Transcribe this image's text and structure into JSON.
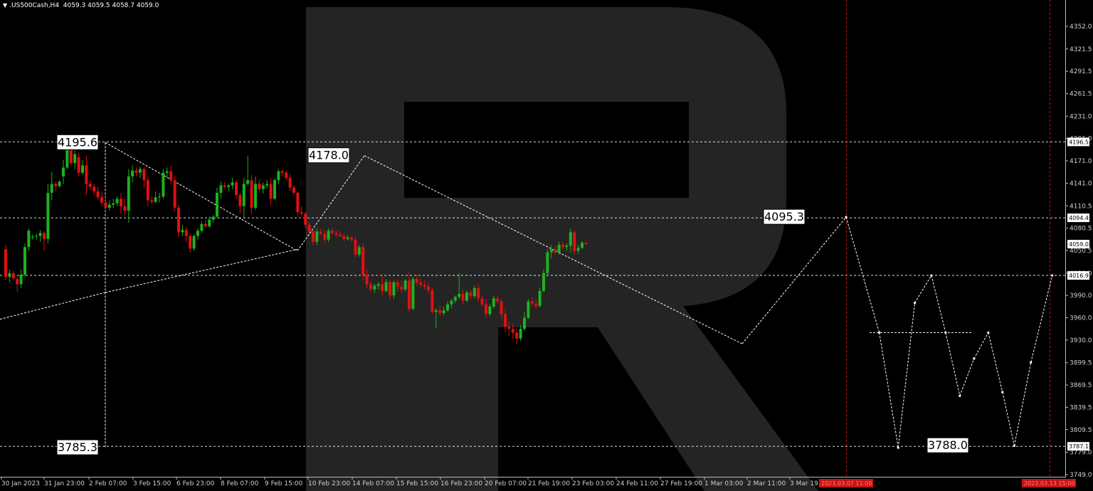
{
  "header": {
    "symbol": ".US500Cash,H4",
    "ohlc": "4059.3 4059.5 4058.7 4059.0"
  },
  "colors": {
    "background": "#000000",
    "bull": "#1db21d",
    "bear": "#e01010",
    "grid": "#ffffff",
    "vline": "#c81414",
    "watermark": "#2a2a2a"
  },
  "chart_data": {
    "type": "candlestick",
    "ylim": [
      3749.0,
      4372.0
    ],
    "y_ticks": [
      4352.0,
      4321.5,
      4291.5,
      4261.5,
      4231.0,
      4201.0,
      4171.0,
      4141.0,
      4110.5,
      4080.5,
      4050.5,
      4020.0,
      3990.0,
      3960.0,
      3930.0,
      3899.5,
      3869.5,
      3839.5,
      3809.5,
      3779.0,
      3749.0
    ],
    "x_labels": [
      "30 Jan 2023",
      "31 Jan 23:00",
      "2 Feb 07:00",
      "3 Feb 15:00",
      "6 Feb 23:00",
      "8 Feb 07:00",
      "9 Feb 15:00",
      "10 Feb 23:00",
      "14 Feb 07:00",
      "15 Feb 15:00",
      "16 Feb 23:00",
      "20 Feb 07:00",
      "21 Feb 19:00",
      "23 Feb 03:00",
      "24 Feb 11:00",
      "27 Feb 19:00",
      "1 Mar 03:00",
      "2 Mar 11:00",
      "3 Mar 19:00"
    ],
    "time_markers": [
      "2023.03.07 11:00",
      "2023.03.13 15:00"
    ],
    "price_tags": [
      {
        "value": 4196.5,
        "label": "4196.5",
        "color": "#ffffff"
      },
      {
        "value": 4094.4,
        "label": "4094.4",
        "color": "#ffffff"
      },
      {
        "value": 4059.0,
        "label": "4059.0",
        "color": "#ffffff"
      },
      {
        "value": 4016.9,
        "label": "4016.9",
        "color": "#ffffff"
      },
      {
        "value": 3787.1,
        "label": "3787.1",
        "color": "#ffffff"
      }
    ],
    "horizontal_levels": [
      4196.5,
      4094.4,
      4016.9,
      3787.1
    ],
    "annotations": [
      {
        "label": "4195.6",
        "value": 4195.6
      },
      {
        "label": "4178.0",
        "value": 4178.0
      },
      {
        "label": "4095.3",
        "value": 4095.3
      },
      {
        "label": "3785.3",
        "value": 3785.3
      },
      {
        "label": "3788.0",
        "value": 3788.0
      }
    ],
    "candles": [
      {
        "o": 4052,
        "h": 4058,
        "l": 4010,
        "c": 4015
      },
      {
        "o": 4015,
        "h": 4025,
        "l": 4008,
        "c": 4020
      },
      {
        "o": 4020,
        "h": 4023,
        "l": 4010,
        "c": 4013
      },
      {
        "o": 4012,
        "h": 4018,
        "l": 3995,
        "c": 4005
      },
      {
        "o": 4005,
        "h": 4025,
        "l": 4000,
        "c": 4018
      },
      {
        "o": 4018,
        "h": 4060,
        "l": 4015,
        "c": 4055
      },
      {
        "o": 4055,
        "h": 4080,
        "l": 4050,
        "c": 4077
      },
      {
        "o": 4068,
        "h": 4072,
        "l": 4065,
        "c": 4069
      },
      {
        "o": 4069,
        "h": 4073,
        "l": 4065,
        "c": 4070
      },
      {
        "o": 4070,
        "h": 4078,
        "l": 4062,
        "c": 4074
      },
      {
        "o": 4074,
        "h": 4076,
        "l": 4050,
        "c": 4066
      },
      {
        "o": 4066,
        "h": 4140,
        "l": 4060,
        "c": 4128
      },
      {
        "o": 4128,
        "h": 4156,
        "l": 4118,
        "c": 4140
      },
      {
        "o": 4140,
        "h": 4143,
        "l": 4130,
        "c": 4137
      },
      {
        "o": 4137,
        "h": 4145,
        "l": 4135,
        "c": 4143
      },
      {
        "o": 4150,
        "h": 4172,
        "l": 4140,
        "c": 4162
      },
      {
        "o": 4162,
        "h": 4193,
        "l": 4160,
        "c": 4188
      },
      {
        "o": 4188,
        "h": 4195,
        "l": 4165,
        "c": 4168
      },
      {
        "o": 4168,
        "h": 4185,
        "l": 4160,
        "c": 4180
      },
      {
        "o": 4176,
        "h": 4182,
        "l": 4150,
        "c": 4155
      },
      {
        "o": 4155,
        "h": 4172,
        "l": 4152,
        "c": 4165
      },
      {
        "o": 4165,
        "h": 4178,
        "l": 4125,
        "c": 4140
      },
      {
        "o": 4140,
        "h": 4145,
        "l": 4132,
        "c": 4136
      },
      {
        "o": 4136,
        "h": 4140,
        "l": 4125,
        "c": 4130
      },
      {
        "o": 4130,
        "h": 4136,
        "l": 4118,
        "c": 4122
      },
      {
        "o": 4122,
        "h": 4130,
        "l": 4110,
        "c": 4115
      },
      {
        "o": 4115,
        "h": 4125,
        "l": 4103,
        "c": 4108
      },
      {
        "o": 4108,
        "h": 4118,
        "l": 4104,
        "c": 4112
      },
      {
        "o": 4112,
        "h": 4120,
        "l": 4108,
        "c": 4114
      },
      {
        "o": 4114,
        "h": 4123,
        "l": 4110,
        "c": 4120
      },
      {
        "o": 4120,
        "h": 4128,
        "l": 4100,
        "c": 4110
      },
      {
        "o": 4110,
        "h": 4120,
        "l": 4098,
        "c": 4104
      },
      {
        "o": 4104,
        "h": 4160,
        "l": 4088,
        "c": 4150
      },
      {
        "o": 4150,
        "h": 4165,
        "l": 4142,
        "c": 4158
      },
      {
        "o": 4158,
        "h": 4162,
        "l": 4150,
        "c": 4155
      },
      {
        "o": 4155,
        "h": 4163,
        "l": 4148,
        "c": 4160
      },
      {
        "o": 4160,
        "h": 4162,
        "l": 4135,
        "c": 4145
      },
      {
        "o": 4145,
        "h": 4150,
        "l": 4110,
        "c": 4118
      },
      {
        "o": 4118,
        "h": 4124,
        "l": 4113,
        "c": 4116
      },
      {
        "o": 4116,
        "h": 4130,
        "l": 4114,
        "c": 4122
      },
      {
        "o": 4122,
        "h": 4128,
        "l": 4115,
        "c": 4123
      },
      {
        "o": 4123,
        "h": 4160,
        "l": 4120,
        "c": 4155
      },
      {
        "o": 4155,
        "h": 4162,
        "l": 4148,
        "c": 4157
      },
      {
        "o": 4157,
        "h": 4165,
        "l": 4140,
        "c": 4145
      },
      {
        "o": 4145,
        "h": 4150,
        "l": 4103,
        "c": 4108
      },
      {
        "o": 4108,
        "h": 4112,
        "l": 4068,
        "c": 4075
      },
      {
        "o": 4075,
        "h": 4085,
        "l": 4070,
        "c": 4078
      },
      {
        "o": 4078,
        "h": 4082,
        "l": 4062,
        "c": 4070
      },
      {
        "o": 4070,
        "h": 4073,
        "l": 4048,
        "c": 4053
      },
      {
        "o": 4053,
        "h": 4072,
        "l": 4050,
        "c": 4070
      },
      {
        "o": 4070,
        "h": 4080,
        "l": 4065,
        "c": 4077
      },
      {
        "o": 4077,
        "h": 4090,
        "l": 4074,
        "c": 4086
      },
      {
        "o": 4086,
        "h": 4092,
        "l": 4080,
        "c": 4083
      },
      {
        "o": 4083,
        "h": 4096,
        "l": 4081,
        "c": 4092
      },
      {
        "o": 4092,
        "h": 4098,
        "l": 4088,
        "c": 4096
      },
      {
        "o": 4096,
        "h": 4135,
        "l": 4094,
        "c": 4128
      },
      {
        "o": 4128,
        "h": 4143,
        "l": 4120,
        "c": 4138
      },
      {
        "o": 4138,
        "h": 4142,
        "l": 4133,
        "c": 4136
      },
      {
        "o": 4136,
        "h": 4140,
        "l": 4130,
        "c": 4138
      },
      {
        "o": 4138,
        "h": 4148,
        "l": 4133,
        "c": 4142
      },
      {
        "o": 4142,
        "h": 4145,
        "l": 4120,
        "c": 4125
      },
      {
        "o": 4125,
        "h": 4128,
        "l": 4100,
        "c": 4110
      },
      {
        "o": 4110,
        "h": 4148,
        "l": 4095,
        "c": 4140
      },
      {
        "o": 4140,
        "h": 4178,
        "l": 4138,
        "c": 4145
      },
      {
        "o": 4145,
        "h": 4152,
        "l": 4100,
        "c": 4108
      },
      {
        "o": 4108,
        "h": 4150,
        "l": 4105,
        "c": 4140
      },
      {
        "o": 4140,
        "h": 4145,
        "l": 4128,
        "c": 4133
      },
      {
        "o": 4133,
        "h": 4142,
        "l": 4127,
        "c": 4138
      },
      {
        "o": 4138,
        "h": 4145,
        "l": 4134,
        "c": 4140
      },
      {
        "o": 4140,
        "h": 4148,
        "l": 4112,
        "c": 4120
      },
      {
        "o": 4120,
        "h": 4148,
        "l": 4118,
        "c": 4145
      },
      {
        "o": 4145,
        "h": 4160,
        "l": 4140,
        "c": 4157
      },
      {
        "o": 4157,
        "h": 4160,
        "l": 4150,
        "c": 4155
      },
      {
        "o": 4155,
        "h": 4158,
        "l": 4145,
        "c": 4148
      },
      {
        "o": 4148,
        "h": 4153,
        "l": 4130,
        "c": 4135
      },
      {
        "o": 4135,
        "h": 4138,
        "l": 4125,
        "c": 4128
      },
      {
        "o": 4128,
        "h": 4130,
        "l": 4095,
        "c": 4102
      },
      {
        "o": 4102,
        "h": 4110,
        "l": 4095,
        "c": 4100
      },
      {
        "o": 4100,
        "h": 4103,
        "l": 4080,
        "c": 4085
      },
      {
        "o": 4085,
        "h": 4088,
        "l": 4070,
        "c": 4076
      },
      {
        "o": 4076,
        "h": 4080,
        "l": 4058,
        "c": 4062
      },
      {
        "o": 4062,
        "h": 4080,
        "l": 4058,
        "c": 4076
      },
      {
        "o": 4076,
        "h": 4080,
        "l": 4070,
        "c": 4073
      },
      {
        "o": 4073,
        "h": 4078,
        "l": 4060,
        "c": 4065
      },
      {
        "o": 4065,
        "h": 4080,
        "l": 4062,
        "c": 4077
      },
      {
        "o": 4077,
        "h": 4080,
        "l": 4072,
        "c": 4074
      },
      {
        "o": 4074,
        "h": 4078,
        "l": 4069,
        "c": 4072
      },
      {
        "o": 4072,
        "h": 4076,
        "l": 4068,
        "c": 4070
      },
      {
        "o": 4070,
        "h": 4073,
        "l": 4063,
        "c": 4066
      },
      {
        "o": 4066,
        "h": 4071,
        "l": 4064,
        "c": 4068
      },
      {
        "o": 4068,
        "h": 4070,
        "l": 4062,
        "c": 4065
      },
      {
        "o": 4065,
        "h": 4068,
        "l": 4040,
        "c": 4045
      },
      {
        "o": 4045,
        "h": 4058,
        "l": 4042,
        "c": 4055
      },
      {
        "o": 4055,
        "h": 4060,
        "l": 4010,
        "c": 4018
      },
      {
        "o": 4018,
        "h": 4025,
        "l": 4000,
        "c": 4005
      },
      {
        "o": 4005,
        "h": 4010,
        "l": 3995,
        "c": 3998
      },
      {
        "o": 3998,
        "h": 4006,
        "l": 3993,
        "c": 4003
      },
      {
        "o": 4003,
        "h": 4008,
        "l": 3998,
        "c": 4005
      },
      {
        "o": 4005,
        "h": 4018,
        "l": 3990,
        "c": 3996
      },
      {
        "o": 3996,
        "h": 4012,
        "l": 3994,
        "c": 4008
      },
      {
        "o": 4008,
        "h": 4012,
        "l": 3985,
        "c": 3990
      },
      {
        "o": 3990,
        "h": 4010,
        "l": 3985,
        "c": 4008
      },
      {
        "o": 4008,
        "h": 4012,
        "l": 3995,
        "c": 4002
      },
      {
        "o": 4002,
        "h": 4010,
        "l": 3994,
        "c": 3998
      },
      {
        "o": 3998,
        "h": 4012,
        "l": 3995,
        "c": 4010
      },
      {
        "o": 4010,
        "h": 4022,
        "l": 3968,
        "c": 3972
      },
      {
        "o": 3972,
        "h": 4015,
        "l": 3970,
        "c": 4012
      },
      {
        "o": 4012,
        "h": 4018,
        "l": 4003,
        "c": 4007
      },
      {
        "o": 4007,
        "h": 4013,
        "l": 4000,
        "c": 4004
      },
      {
        "o": 4004,
        "h": 4010,
        "l": 3998,
        "c": 4002
      },
      {
        "o": 4002,
        "h": 4006,
        "l": 3992,
        "c": 3997
      },
      {
        "o": 3997,
        "h": 4000,
        "l": 3965,
        "c": 3968
      },
      {
        "o": 3968,
        "h": 3973,
        "l": 3946,
        "c": 3970
      },
      {
        "o": 3970,
        "h": 3976,
        "l": 3962,
        "c": 3966
      },
      {
        "o": 3966,
        "h": 3975,
        "l": 3963,
        "c": 3970
      },
      {
        "o": 3970,
        "h": 3982,
        "l": 3968,
        "c": 3978
      },
      {
        "o": 3978,
        "h": 3985,
        "l": 3973,
        "c": 3983
      },
      {
        "o": 3983,
        "h": 3990,
        "l": 3980,
        "c": 3988
      },
      {
        "o": 3988,
        "h": 4020,
        "l": 3985,
        "c": 3992
      },
      {
        "o": 3992,
        "h": 3998,
        "l": 3978,
        "c": 3983
      },
      {
        "o": 3983,
        "h": 3997,
        "l": 3981,
        "c": 3994
      },
      {
        "o": 3994,
        "h": 3998,
        "l": 3985,
        "c": 3989
      },
      {
        "o": 3989,
        "h": 4003,
        "l": 3986,
        "c": 4000
      },
      {
        "o": 4000,
        "h": 4005,
        "l": 3982,
        "c": 3986
      },
      {
        "o": 3986,
        "h": 3990,
        "l": 3975,
        "c": 3978
      },
      {
        "o": 3978,
        "h": 3985,
        "l": 3960,
        "c": 3965
      },
      {
        "o": 3965,
        "h": 3978,
        "l": 3962,
        "c": 3975
      },
      {
        "o": 3975,
        "h": 3990,
        "l": 3972,
        "c": 3986
      },
      {
        "o": 3986,
        "h": 3990,
        "l": 3978,
        "c": 3982
      },
      {
        "o": 3982,
        "h": 3986,
        "l": 3958,
        "c": 3965
      },
      {
        "o": 3965,
        "h": 3972,
        "l": 3940,
        "c": 3948
      },
      {
        "o": 3948,
        "h": 3955,
        "l": 3935,
        "c": 3945
      },
      {
        "o": 3945,
        "h": 3952,
        "l": 3932,
        "c": 3940
      },
      {
        "o": 3940,
        "h": 3945,
        "l": 3925,
        "c": 3932
      },
      {
        "o": 3932,
        "h": 3950,
        "l": 3929,
        "c": 3945
      },
      {
        "o": 3945,
        "h": 3968,
        "l": 3942,
        "c": 3960
      },
      {
        "o": 3960,
        "h": 3985,
        "l": 3958,
        "c": 3982
      },
      {
        "o": 3982,
        "h": 3988,
        "l": 3975,
        "c": 3979
      },
      {
        "o": 3979,
        "h": 3985,
        "l": 3972,
        "c": 3976
      },
      {
        "o": 3976,
        "h": 4000,
        "l": 3974,
        "c": 3996
      },
      {
        "o": 3996,
        "h": 4025,
        "l": 3994,
        "c": 4020
      },
      {
        "o": 4020,
        "h": 4052,
        "l": 4018,
        "c": 4048
      },
      {
        "o": 4048,
        "h": 4058,
        "l": 4040,
        "c": 4052
      },
      {
        "o": 4052,
        "h": 4056,
        "l": 4045,
        "c": 4048
      },
      {
        "o": 4048,
        "h": 4062,
        "l": 4045,
        "c": 4058
      },
      {
        "o": 4058,
        "h": 4062,
        "l": 4052,
        "c": 4055
      },
      {
        "o": 4055,
        "h": 4060,
        "l": 4050,
        "c": 4057
      },
      {
        "o": 4057,
        "h": 4080,
        "l": 4048,
        "c": 4075
      },
      {
        "o": 4075,
        "h": 4078,
        "l": 4045,
        "c": 4050
      },
      {
        "o": 4050,
        "h": 4058,
        "l": 4046,
        "c": 4054
      },
      {
        "o": 4054,
        "h": 4063,
        "l": 4052,
        "c": 4061
      },
      {
        "o": 4061,
        "h": 4062,
        "l": 4058,
        "c": 4059
      }
    ],
    "forecast_path": [
      {
        "slot": 189,
        "value": 4095.3
      },
      {
        "slot": 203,
        "value": 3940
      },
      {
        "slot": 211,
        "value": 3785.3
      },
      {
        "slot": 218,
        "value": 3980
      },
      {
        "slot": 225,
        "value": 4016.9
      },
      {
        "slot": 231,
        "value": 3940
      },
      {
        "slot": 237,
        "value": 3855
      },
      {
        "slot": 243,
        "value": 3905
      },
      {
        "slot": 249,
        "value": 3940
      },
      {
        "slot": 255,
        "value": 3860
      },
      {
        "slot": 260,
        "value": 3788.0
      },
      {
        "slot": 267,
        "value": 3900
      },
      {
        "slot": 276,
        "value": 4016.9
      }
    ]
  }
}
